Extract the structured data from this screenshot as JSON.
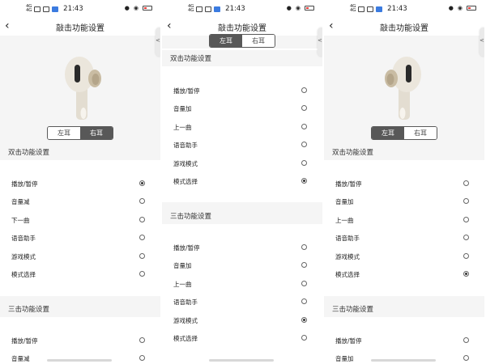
{
  "status_bar": {
    "signal_a": "4G",
    "signal_b": "4G",
    "time": "21:43"
  },
  "screens": [
    {
      "title": "敲击功能设置",
      "side_tab_glyph": "<",
      "ear_tabs": {
        "left": "左耳",
        "right": "右耳",
        "selected": "right"
      },
      "double_tap": {
        "header": "双击功能设置",
        "options": [
          {
            "label": "播放/暂停",
            "selected": true
          },
          {
            "label": "音量减",
            "selected": false
          },
          {
            "label": "下一曲",
            "selected": false
          },
          {
            "label": "语音助手",
            "selected": false
          },
          {
            "label": "游戏模式",
            "selected": false
          },
          {
            "label": "模式选择",
            "selected": false
          }
        ]
      },
      "triple_tap": {
        "header": "三击功能设置",
        "options": [
          {
            "label": "播放/暂停",
            "selected": false
          },
          {
            "label": "音量减",
            "selected": false
          }
        ]
      }
    },
    {
      "title": "敲击功能设置",
      "side_tab_glyph": "<",
      "ear_tabs": {
        "left": "左耳",
        "right": "右耳",
        "selected": "left"
      },
      "double_tap": {
        "header": "双击功能设置",
        "options": [
          {
            "label": "播放/暂停",
            "selected": false
          },
          {
            "label": "音量加",
            "selected": false
          },
          {
            "label": "上一曲",
            "selected": false
          },
          {
            "label": "语音助手",
            "selected": false
          },
          {
            "label": "游戏模式",
            "selected": false
          },
          {
            "label": "模式选择",
            "selected": true
          }
        ]
      },
      "triple_tap": {
        "header": "三击功能设置",
        "options": [
          {
            "label": "播放/暂停",
            "selected": false
          },
          {
            "label": "音量加",
            "selected": false
          },
          {
            "label": "上一曲",
            "selected": false
          },
          {
            "label": "语音助手",
            "selected": false
          },
          {
            "label": "游戏模式",
            "selected": true
          },
          {
            "label": "模式选择",
            "selected": false
          }
        ]
      }
    },
    {
      "title": "敲击功能设置",
      "side_tab_glyph": "<",
      "ear_tabs": {
        "left": "左耳",
        "right": "右耳",
        "selected": "left"
      },
      "double_tap": {
        "header": "双击功能设置",
        "options": [
          {
            "label": "播放/暂停",
            "selected": false
          },
          {
            "label": "音量加",
            "selected": false
          },
          {
            "label": "上一曲",
            "selected": false
          },
          {
            "label": "语音助手",
            "selected": false
          },
          {
            "label": "游戏模式",
            "selected": false
          },
          {
            "label": "模式选择",
            "selected": true
          }
        ]
      },
      "triple_tap": {
        "header": "三击功能设置",
        "options": [
          {
            "label": "播放/暂停",
            "selected": false
          },
          {
            "label": "音量加",
            "selected": false
          }
        ]
      }
    }
  ],
  "colors": {
    "segment_active": "#585858",
    "section_bg": "#f5f5f5",
    "status_blue": "#3b7be0",
    "battery_red": "#e53935"
  }
}
